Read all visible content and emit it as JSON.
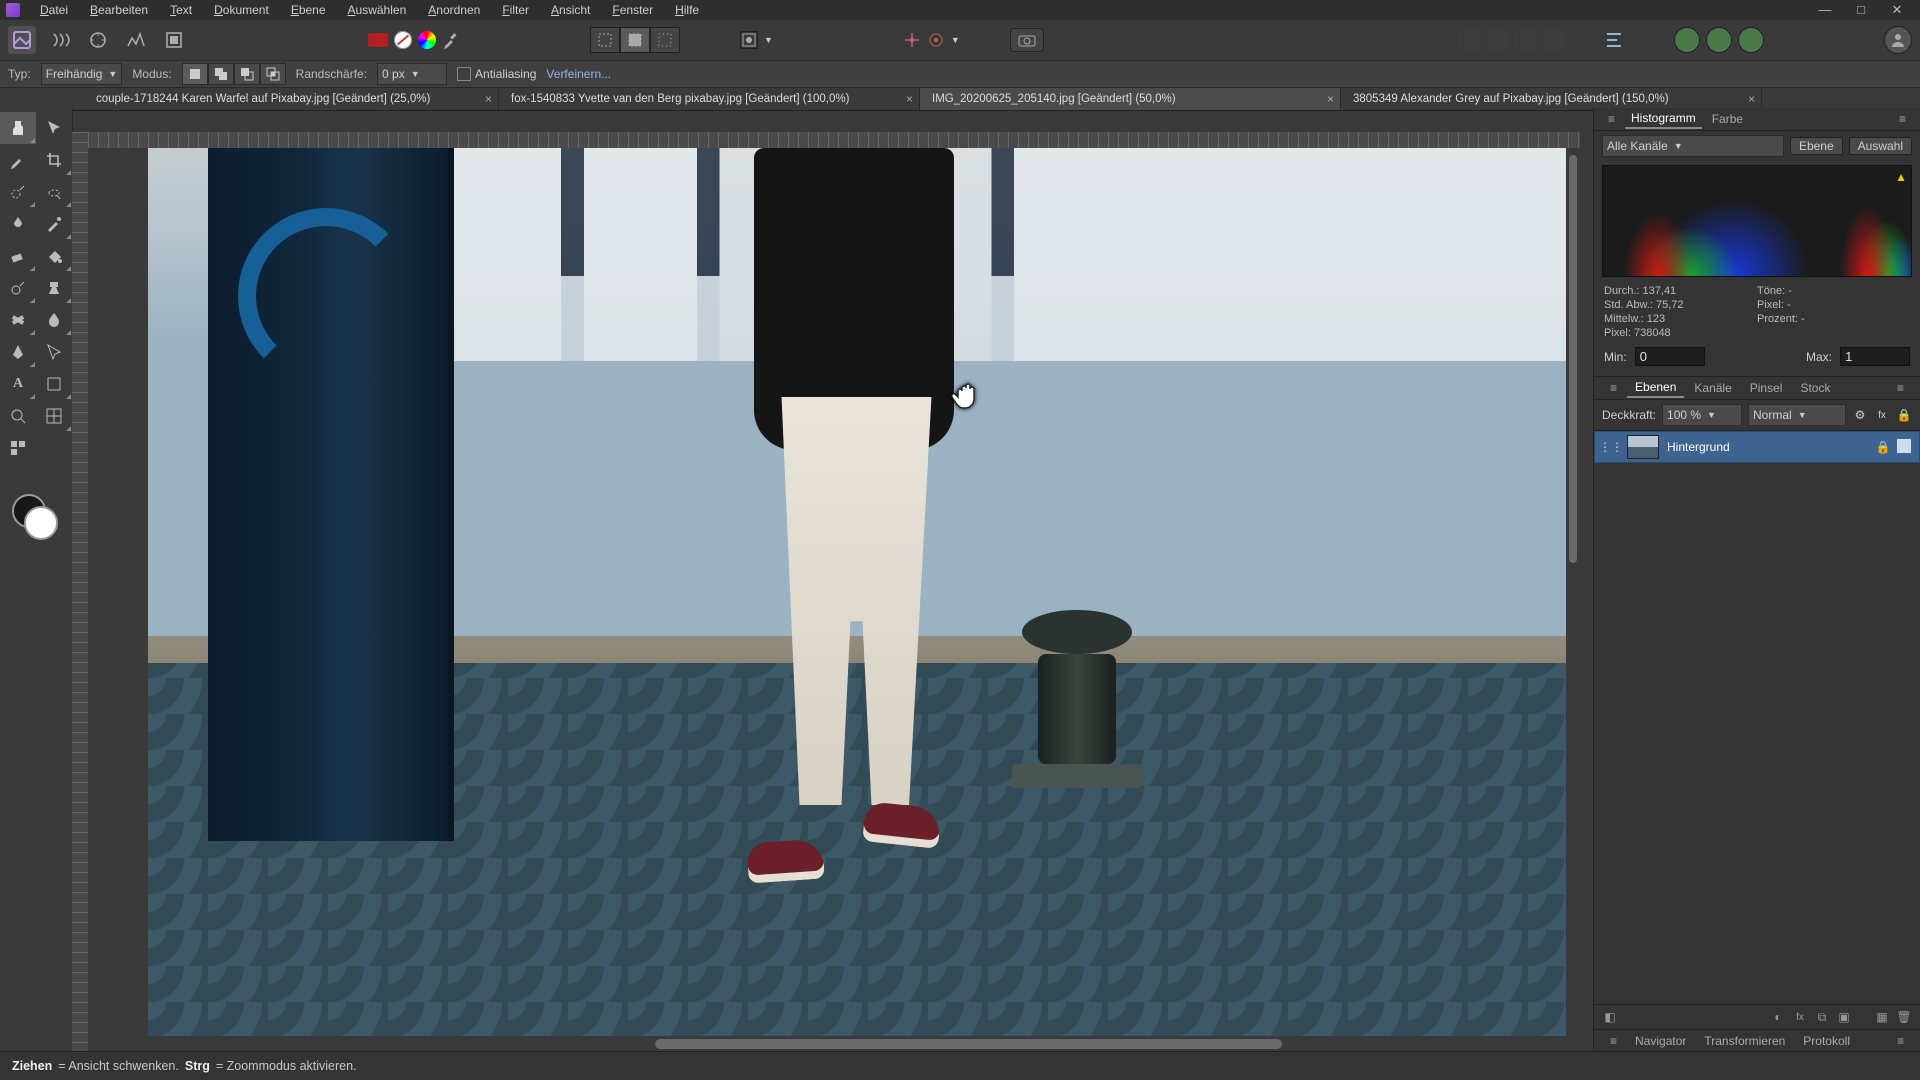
{
  "menu": [
    "Datei",
    "Bearbeiten",
    "Text",
    "Dokument",
    "Ebene",
    "Auswählen",
    "Anordnen",
    "Filter",
    "Ansicht",
    "Fenster",
    "Hilfe"
  ],
  "context": {
    "typ_label": "Typ:",
    "typ_value": "Freihändig",
    "modus_label": "Modus:",
    "feather_label": "Randschärfe:",
    "feather_value": "0 px",
    "antialias": "Antialiasing",
    "refine": "Verfeinern..."
  },
  "tabs": [
    {
      "label": "couple-1718244 Karen Warfel auf Pixabay.jpg [Geändert] (25,0%)",
      "active": false
    },
    {
      "label": "fox-1540833 Yvette van den Berg pixabay.jpg [Geändert] (100,0%)",
      "active": false
    },
    {
      "label": "IMG_20200625_205140.jpg [Geändert] (50,0%)",
      "active": true
    },
    {
      "label": "3805349 Alexander Grey auf Pixabay.jpg [Geändert] (150,0%)",
      "active": false
    }
  ],
  "histogram": {
    "tab1": "Histogramm",
    "tab2": "Farbe",
    "channels": "Alle Kanäle",
    "btn_ebene": "Ebene",
    "btn_auswahl": "Auswahl",
    "durch_l": "Durch.:",
    "durch_v": "137,41",
    "std_l": "Std. Abw.:",
    "std_v": "75,72",
    "mittel_l": "Mittelw.:",
    "mittel_v": "123",
    "pixel_l": "Pixel:",
    "pixel_v": "738048",
    "tone_l": "Töne:",
    "tone_v": "-",
    "proz_l": "Prozent:",
    "proz_v": "-",
    "pix2_l": "Pixel:",
    "pix2_v": "-",
    "min_l": "Min:",
    "min_v": "0",
    "max_l": "Max:",
    "max_v": "1"
  },
  "layers": {
    "tabs": [
      "Ebenen",
      "Kanäle",
      "Pinsel",
      "Stock"
    ],
    "opacity_l": "Deckkraft:",
    "opacity_v": "100 %",
    "blend": "Normal",
    "layer_name": "Hintergrund"
  },
  "bottom_tabs": [
    "Navigator",
    "Transformieren",
    "Protokoll"
  ],
  "status": {
    "drag": "Ziehen",
    "drag_desc": " = Ansicht schwenken. ",
    "ctrl": "Strg",
    "ctrl_desc": " = Zoommodus aktivieren."
  }
}
